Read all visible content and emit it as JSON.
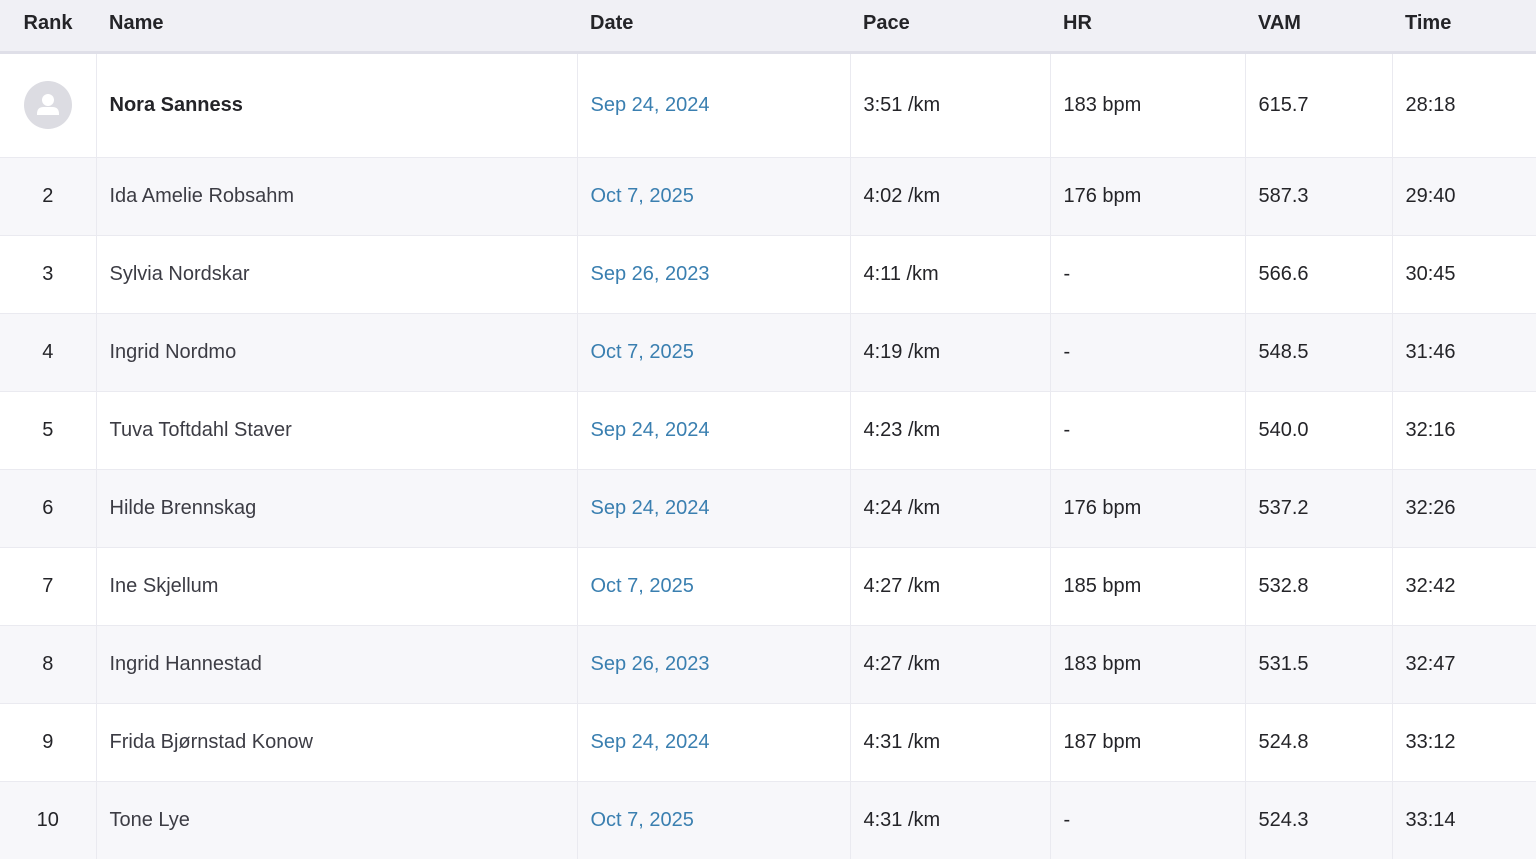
{
  "columns": {
    "rank": "Rank",
    "name": "Name",
    "date": "Date",
    "pace": "Pace",
    "hr": "HR",
    "vam": "VAM",
    "time": "Time"
  },
  "rows": [
    {
      "rank": "",
      "avatar_icon": "user-placeholder-icon",
      "name": "Nora Sanness",
      "date": "Sep 24, 2024",
      "pace": "3:51 /km",
      "hr": "183 bpm",
      "vam": "615.7",
      "time": "28:18"
    },
    {
      "rank": "2",
      "name": "Ida Amelie Robsahm",
      "date": "Oct 7, 2025",
      "pace": "4:02 /km",
      "hr": "176 bpm",
      "vam": "587.3",
      "time": "29:40"
    },
    {
      "rank": "3",
      "name": "Sylvia Nordskar",
      "date": "Sep 26, 2023",
      "pace": "4:11 /km",
      "hr": "-",
      "vam": "566.6",
      "time": "30:45"
    },
    {
      "rank": "4",
      "name": "Ingrid Nordmo",
      "date": "Oct 7, 2025",
      "pace": "4:19 /km",
      "hr": "-",
      "vam": "548.5",
      "time": "31:46"
    },
    {
      "rank": "5",
      "name": "Tuva Toftdahl Staver",
      "date": "Sep 24, 2024",
      "pace": "4:23 /km",
      "hr": "-",
      "vam": "540.0",
      "time": "32:16"
    },
    {
      "rank": "6",
      "name": "Hilde Brennskag",
      "date": "Sep 24, 2024",
      "pace": "4:24 /km",
      "hr": "176 bpm",
      "vam": "537.2",
      "time": "32:26"
    },
    {
      "rank": "7",
      "name": "Ine Skjellum",
      "date": "Oct 7, 2025",
      "pace": "4:27 /km",
      "hr": "185 bpm",
      "vam": "532.8",
      "time": "32:42"
    },
    {
      "rank": "8",
      "name": "Ingrid Hannestad",
      "date": "Sep 26, 2023",
      "pace": "4:27 /km",
      "hr": "183 bpm",
      "vam": "531.5",
      "time": "32:47"
    },
    {
      "rank": "9",
      "name": "Frida Bjørnstad Konow",
      "date": "Sep 24, 2024",
      "pace": "4:31 /km",
      "hr": "187 bpm",
      "vam": "524.8",
      "time": "33:12"
    },
    {
      "rank": "10",
      "name": "Tone Lye",
      "date": "Oct 7, 2025",
      "pace": "4:31 /km",
      "hr": "-",
      "vam": "524.3",
      "time": "33:14"
    }
  ],
  "colors": {
    "header_bg": "#f0f0f5",
    "row_alt_bg": "#f7f7fa",
    "date_link": "#3a7fb0",
    "text": "#242428"
  }
}
